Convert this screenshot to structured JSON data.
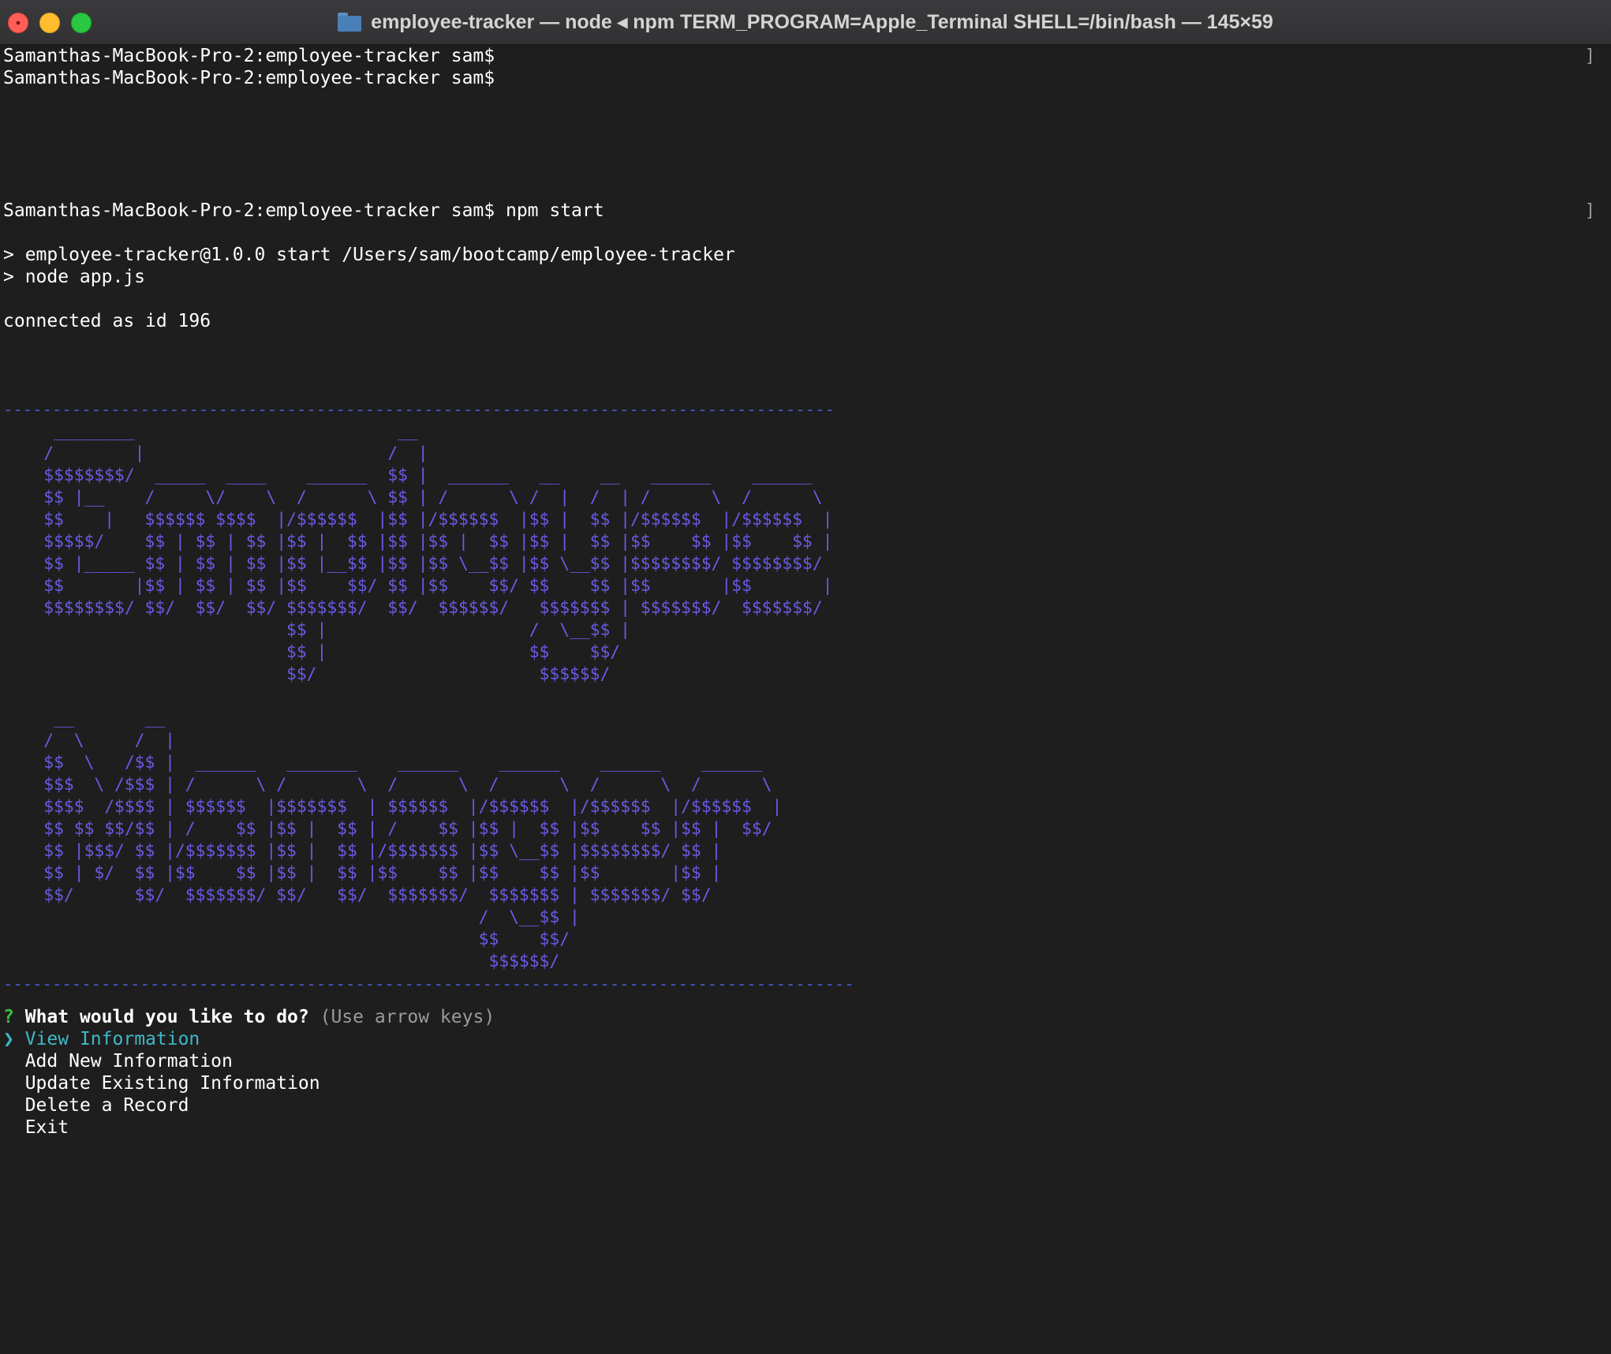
{
  "window": {
    "title": "employee-tracker — node ◂ npm TERM_PROGRAM=Apple_Terminal SHELL=/bin/bash — 145×59"
  },
  "terminal": {
    "prompt_lines": [
      "Samanthas-MacBook-Pro-2:employee-tracker sam$",
      "Samanthas-MacBook-Pro-2:employee-tracker sam$"
    ],
    "command_line": "Samanthas-MacBook-Pro-2:employee-tracker sam$ npm start",
    "npm_output": [
      "> employee-tracker@1.0.0 start /Users/sam/bootcamp/employee-tracker",
      "> node app.js"
    ],
    "connection_status": "connected as id 196",
    "rule_top": "-------------------------------------------------------------------------------------",
    "banner_employee": [
      "     ________                          __",
      "    /        |                        /  |",
      "    $$$$$$$$/  _____  ____    ______  $$ |  ______   __    __   ______    ______",
      "    $$ |__    /     \\/    \\  /      \\ $$ | /      \\ /  |  /  | /      \\  /      \\",
      "    $$    |   $$$$$$ $$$$  |/$$$$$$  |$$ |/$$$$$$  |$$ |  $$ |/$$$$$$  |/$$$$$$  |",
      "    $$$$$/    $$ | $$ | $$ |$$ |  $$ |$$ |$$ |  $$ |$$ |  $$ |$$    $$ |$$    $$ |",
      "    $$ |_____ $$ | $$ | $$ |$$ |__$$ |$$ |$$ \\__$$ |$$ \\__$$ |$$$$$$$$/ $$$$$$$$/",
      "    $$       |$$ | $$ | $$ |$$    $$/ $$ |$$    $$/ $$    $$ |$$       |$$       |",
      "    $$$$$$$$/ $$/  $$/  $$/ $$$$$$$/  $$/  $$$$$$/   $$$$$$$ | $$$$$$$/  $$$$$$$/",
      "                            $$ |                    /  \\__$$ |",
      "                            $$ |                    $$    $$/",
      "                            $$/                      $$$$$$/"
    ],
    "banner_manager": [
      "     __       __",
      "    /  \\     /  |",
      "    $$  \\   /$$ |  ______   _______    ______    ______    ______    ______",
      "    $$$  \\ /$$$ | /      \\ /       \\  /      \\  /      \\  /      \\  /      \\",
      "    $$$$  /$$$$ | $$$$$$  |$$$$$$$  | $$$$$$  |/$$$$$$  |/$$$$$$  |/$$$$$$  |",
      "    $$ $$ $$/$$ | /    $$ |$$ |  $$ | /    $$ |$$ |  $$ |$$    $$ |$$ |  $$/",
      "    $$ |$$$/ $$ |/$$$$$$$ |$$ |  $$ |/$$$$$$$ |$$ \\__$$ |$$$$$$$$/ $$ |",
      "    $$ | $/  $$ |$$    $$ |$$ |  $$ |$$    $$ |$$    $$ |$$       |$$ |",
      "    $$/      $$/  $$$$$$$/ $$/   $$/  $$$$$$$/  $$$$$$$ | $$$$$$$/ $$/",
      "                                               /  \\__$$ |",
      "                                               $$    $$/",
      "                                                $$$$$$/"
    ],
    "rule_bottom": "---------------------------------------------------------------------------------------",
    "question": {
      "mark": "?",
      "text": "What would you like to do?",
      "hint": "(Use arrow keys)"
    },
    "pointer": "❯",
    "menu": [
      "View Information",
      "Add New Information",
      "Update Existing Information",
      "Delete a Record",
      "Exit"
    ],
    "selected_index": 0,
    "scroll_marker": "]"
  },
  "colors": {
    "background": "#1e1e1e",
    "art": "#6b5ae6",
    "selection": "#3fb8c7",
    "question_mark": "#3fbf3f"
  }
}
